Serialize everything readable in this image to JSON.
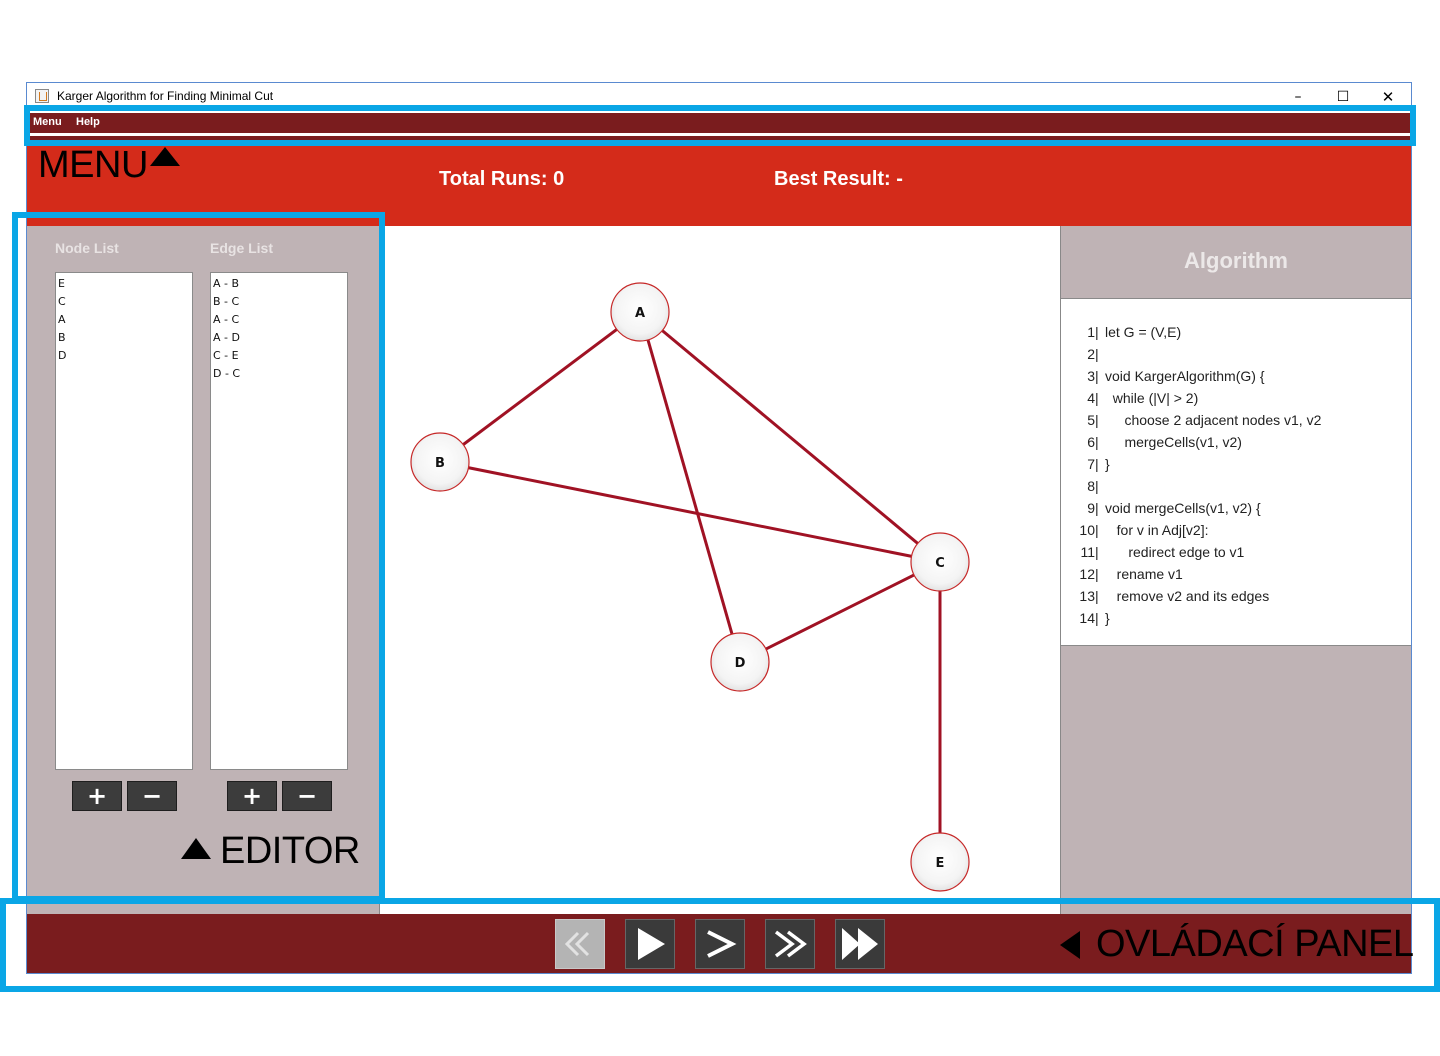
{
  "window": {
    "title": "Karger Algorithm for Finding Minimal Cut",
    "controls": [
      "–",
      "☐",
      "✕"
    ]
  },
  "menubar": {
    "items": [
      "Menu",
      "Help"
    ]
  },
  "header": {
    "total_runs": "Total Runs: 0",
    "best_result": "Best Result: -"
  },
  "editor": {
    "node_list_title": "Node List",
    "edge_list_title": "Edge List",
    "nodes": [
      "E",
      "C",
      "A",
      "B",
      "D"
    ],
    "edges": [
      "A - B",
      "B - C",
      "A - C",
      "A - D",
      "C - E",
      "D - C"
    ],
    "add_label": "+",
    "remove_label": "−"
  },
  "graph": {
    "edge_color": "#a01224",
    "node_border": "#c62828",
    "nodes": [
      {
        "id": "A"
      },
      {
        "id": "B"
      },
      {
        "id": "C"
      },
      {
        "id": "D"
      },
      {
        "id": "E"
      }
    ],
    "edges": [
      [
        "A",
        "B"
      ],
      [
        "A",
        "D"
      ],
      [
        "A",
        "C"
      ],
      [
        "B",
        "C"
      ],
      [
        "C",
        "D"
      ],
      [
        "C",
        "E"
      ]
    ]
  },
  "algorithm": {
    "title": "Algorithm",
    "lines": [
      {
        "num": "1",
        "text": "let G = (V,E)"
      },
      {
        "num": "2",
        "text": ""
      },
      {
        "num": "3",
        "text": "void KargerAlgorithm(G) {"
      },
      {
        "num": "4",
        "text": "  while (|V| > 2)"
      },
      {
        "num": "5",
        "text": "     choose 2 adjacent nodes v1, v2"
      },
      {
        "num": "6",
        "text": "     mergeCells(v1, v2)"
      },
      {
        "num": "7",
        "text": "}"
      },
      {
        "num": "8",
        "text": ""
      },
      {
        "num": "9",
        "text": "void mergeCells(v1, v2) {"
      },
      {
        "num": "10",
        "text": "   for v in Adj[v2]:"
      },
      {
        "num": "11",
        "text": "      redirect edge to v1"
      },
      {
        "num": "12",
        "text": "   rename v1"
      },
      {
        "num": "13",
        "text": "   remove v2 and its edges"
      },
      {
        "num": "14",
        "text": "}"
      }
    ]
  },
  "controls": {
    "buttons": [
      {
        "name": "rewind-button",
        "icon": "double-chevron-left-icon",
        "enabled": false
      },
      {
        "name": "play-button",
        "icon": "play-icon",
        "enabled": true
      },
      {
        "name": "step-button",
        "icon": "chevron-right-icon",
        "enabled": true
      },
      {
        "name": "fast-forward-button",
        "icon": "double-chevron-right-icon",
        "enabled": true
      },
      {
        "name": "skip-to-end-button",
        "icon": "fast-forward-icon",
        "enabled": true
      }
    ]
  },
  "annotations": {
    "menu_label": "MENU",
    "editor_label": "EDITOR",
    "control_label": "OVLÁDACÍ PANEL",
    "highlight_color": "#0aa6e6"
  }
}
